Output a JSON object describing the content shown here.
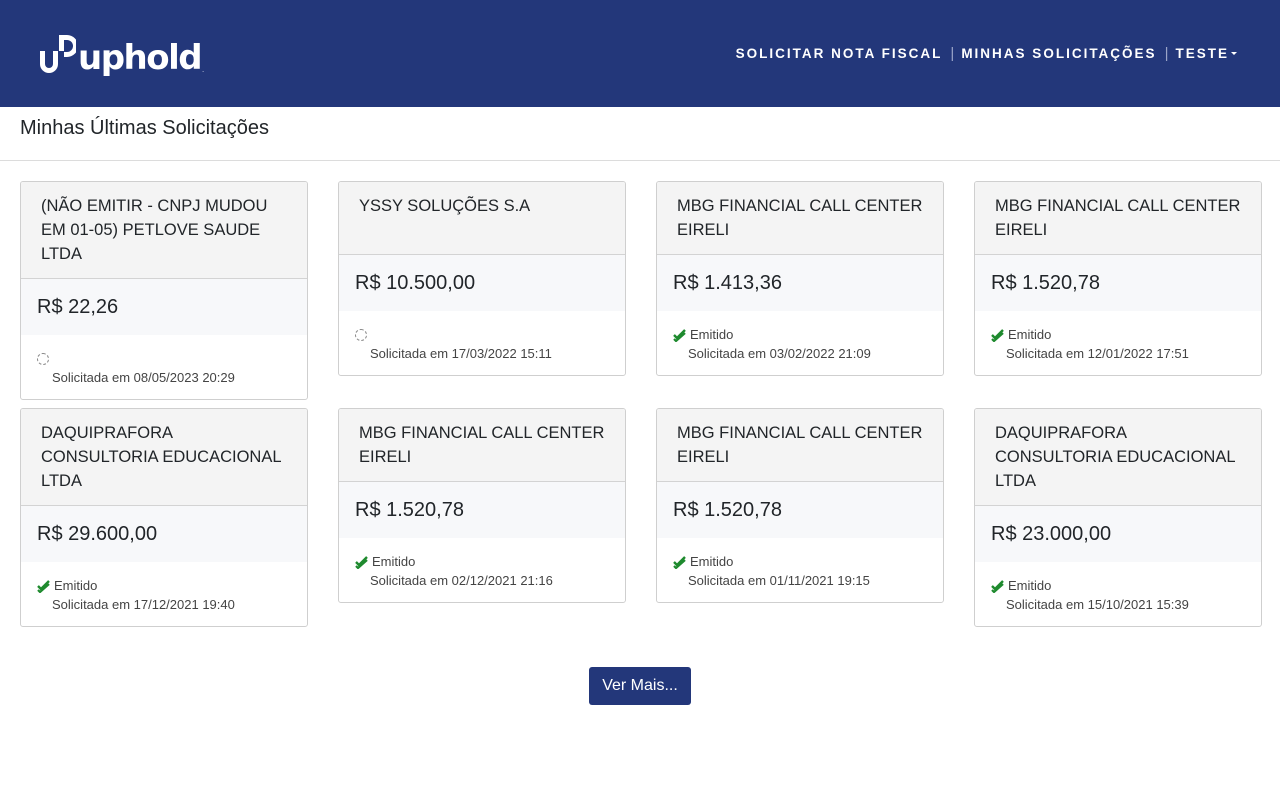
{
  "brand": {
    "name": "uphold",
    "tm": "."
  },
  "nav": {
    "request_invoice": "SOLICITAR NOTA FISCAL",
    "separator": "|",
    "my_requests": "MINHAS SOLICITAÇÕES",
    "user": "TESTE"
  },
  "page": {
    "title": "Minhas Últimas Solicitações"
  },
  "cards": [
    {
      "company": "(NÃO EMITIR - CNPJ MUDOU EM 01-05) PETLOVE SAUDE LTDA",
      "amount": "R$ 22,26",
      "status": "",
      "requested": "Solicitada em 08/05/2023 20:29"
    },
    {
      "company": "YSSY SOLUÇÕES S.A",
      "amount": "R$ 10.500,00",
      "status": "",
      "requested": "Solicitada em 17/03/2022 15:11"
    },
    {
      "company": "MBG FINANCIAL CALL CENTER EIRELI",
      "amount": "R$ 1.413,36",
      "status": "Emitido",
      "requested": "Solicitada em 03/02/2022 21:09"
    },
    {
      "company": "MBG FINANCIAL CALL CENTER EIRELI",
      "amount": "R$ 1.520,78",
      "status": "Emitido",
      "requested": "Solicitada em 12/01/2022 17:51"
    },
    {
      "company": "DAQUIPRAFORA CONSULTORIA EDUCACIONAL LTDA",
      "amount": "R$ 29.600,00",
      "status": "Emitido",
      "requested": "Solicitada em 17/12/2021 19:40"
    },
    {
      "company": "MBG FINANCIAL CALL CENTER EIRELI",
      "amount": "R$ 1.520,78",
      "status": "Emitido",
      "requested": "Solicitada em 02/12/2021 21:16"
    },
    {
      "company": "MBG FINANCIAL CALL CENTER EIRELI",
      "amount": "R$ 1.520,78",
      "status": "Emitido",
      "requested": "Solicitada em 01/11/2021 19:15"
    },
    {
      "company": "DAQUIPRAFORA CONSULTORIA EDUCACIONAL LTDA",
      "amount": "R$ 23.000,00",
      "status": "Emitido",
      "requested": "Solicitada em 15/10/2021 15:39"
    }
  ],
  "icons": {
    "issued": "double-check-icon",
    "pending": "pending-spinner-icon"
  },
  "colors": {
    "navbar": "#23377a",
    "issued": "#1e8a2e",
    "button": "#23377a"
  },
  "actions": {
    "see_more": "Ver Mais..."
  }
}
